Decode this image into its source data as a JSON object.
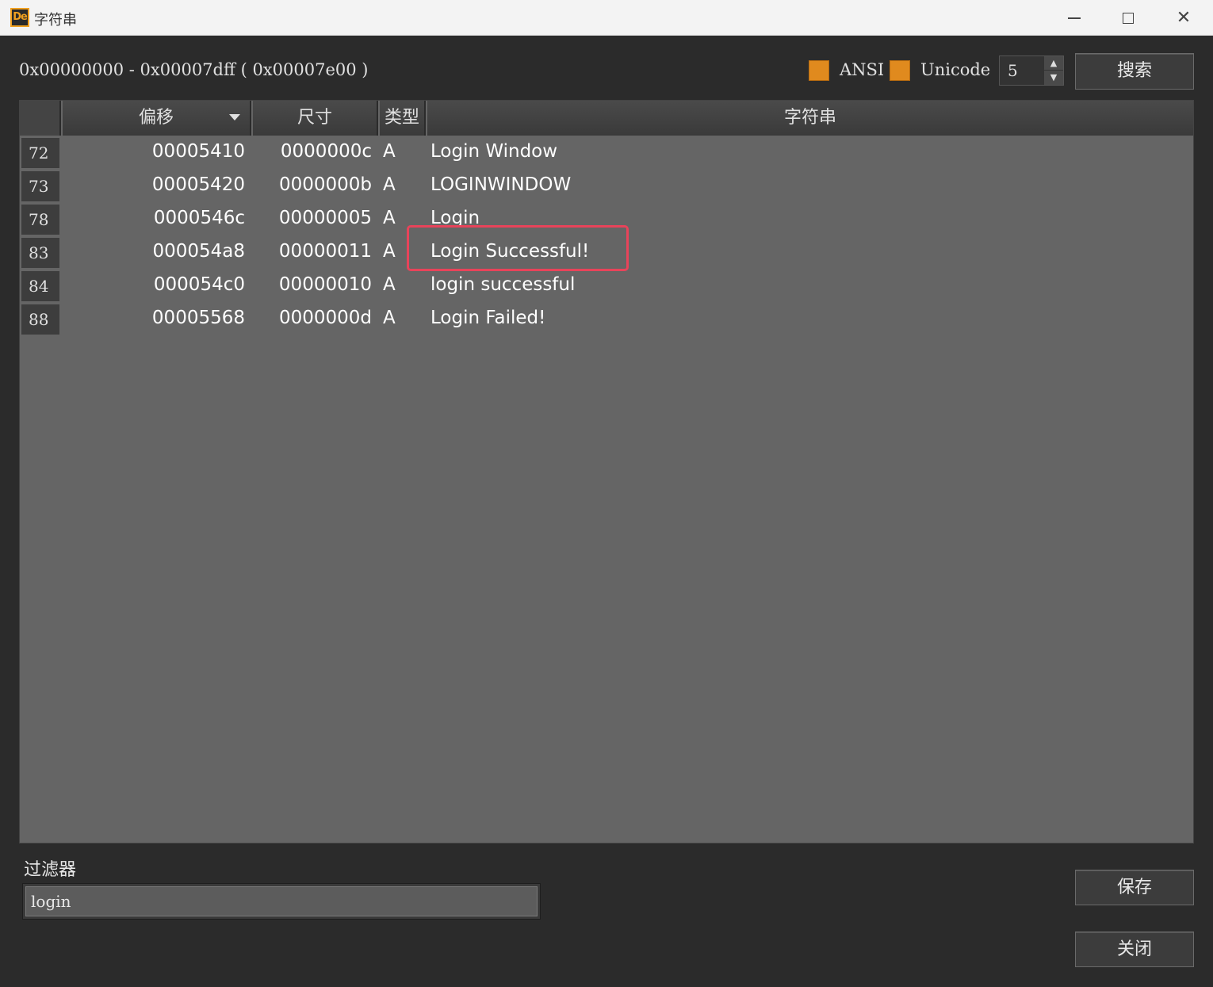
{
  "window": {
    "title": "字符串",
    "icon_text": "De",
    "min_glyph": "",
    "max_glyph": "",
    "close_glyph": "✕"
  },
  "toolbar": {
    "range_text": "0x00000000 - 0x00007dff ( 0x00007e00 )",
    "ansi_label": "ANSI",
    "unicode_label": "Unicode",
    "min_length": "5",
    "search_label": "搜索"
  },
  "table": {
    "columns": {
      "offset": "偏移",
      "size": "尺寸",
      "type": "类型",
      "string": "字符串"
    },
    "rows": [
      {
        "num": "72",
        "offset": "00005410",
        "size": "0000000c",
        "type": "A",
        "string": "Login Window"
      },
      {
        "num": "73",
        "offset": "00005420",
        "size": "0000000b",
        "type": "A",
        "string": "LOGINWINDOW"
      },
      {
        "num": "78",
        "offset": "0000546c",
        "size": "00000005",
        "type": "A",
        "string": "Login"
      },
      {
        "num": "83",
        "offset": "000054a8",
        "size": "00000011",
        "type": "A",
        "string": "Login Successful!"
      },
      {
        "num": "84",
        "offset": "000054c0",
        "size": "00000010",
        "type": "A",
        "string": "login successful"
      },
      {
        "num": "88",
        "offset": "00005568",
        "size": "0000000d",
        "type": "A",
        "string": "Login Failed!"
      }
    ]
  },
  "filter": {
    "label": "过滤器",
    "value": "login"
  },
  "buttons": {
    "save_label": "保存",
    "close_label": "关闭"
  },
  "colors": {
    "checkbox": "#e08a1e",
    "highlight": "#e8435a",
    "table_bg": "#656565",
    "window_bg": "#2b2b2b"
  }
}
